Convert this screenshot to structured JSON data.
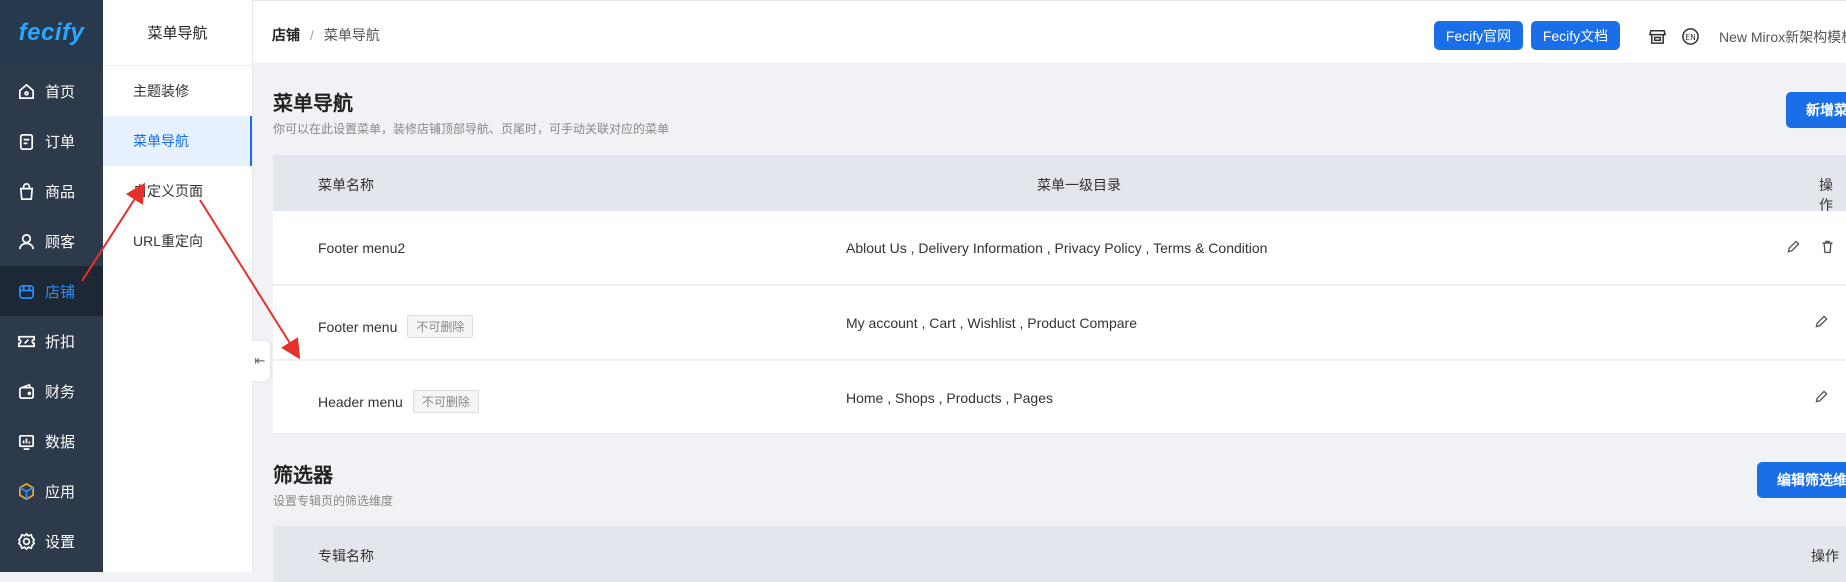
{
  "nav": {
    "logo": "fecify",
    "items": [
      {
        "label": "首页",
        "icon": "home-icon"
      },
      {
        "label": "订单",
        "icon": "order-icon"
      },
      {
        "label": "商品",
        "icon": "bag-icon"
      },
      {
        "label": "顾客",
        "icon": "user-icon"
      },
      {
        "label": "店铺",
        "icon": "store-icon"
      },
      {
        "label": "折扣",
        "icon": "ticket-icon"
      },
      {
        "label": "财务",
        "icon": "wallet-icon"
      },
      {
        "label": "数据",
        "icon": "chart-icon"
      },
      {
        "label": "应用",
        "icon": "cube-icon"
      },
      {
        "label": "设置",
        "icon": "gear-icon"
      }
    ]
  },
  "submenu": {
    "title": "菜单导航",
    "items": [
      {
        "label": "主题装修"
      },
      {
        "label": "菜单导航"
      },
      {
        "label": "自定义页面"
      },
      {
        "label": "URL重定向"
      }
    ]
  },
  "topbar": {
    "breadcrumb_root": "店铺",
    "breadcrumb_sep": "/",
    "breadcrumb_current": "菜单导航",
    "btn_site": "Fecify官网",
    "btn_docs": "Fecify文档",
    "tenant": "New Mirox新架构模板"
  },
  "menu_section": {
    "title": "菜单导航",
    "desc": "你可以在此设置菜单，装修店铺顶部导航、页尾时，可手动关联对应的菜单",
    "add_button": "新增菜单",
    "columns": {
      "name": "菜单名称",
      "dirs": "菜单一级目录",
      "action": "操作"
    },
    "rows": [
      {
        "name": "Footer menu2",
        "tag": "",
        "dirs": "Ablout Us , Delivery Information , Privacy Policy , Terms & Condition"
      },
      {
        "name": "Footer menu",
        "tag": "不可删除",
        "dirs": "My account , Cart , Wishlist , Product Compare"
      },
      {
        "name": "Header menu",
        "tag": "不可删除",
        "dirs": "Home , Shops , Products , Pages"
      }
    ]
  },
  "filter_section": {
    "title": "筛选器",
    "desc": "设置专辑页的筛选维度",
    "edit_button": "编辑筛选维度",
    "columns": {
      "name": "专辑名称",
      "action": "操作"
    }
  },
  "colors": {
    "accent": "#1a6fe8",
    "nav_bg": "#2d3a4b",
    "annotation": "#e8302a"
  }
}
